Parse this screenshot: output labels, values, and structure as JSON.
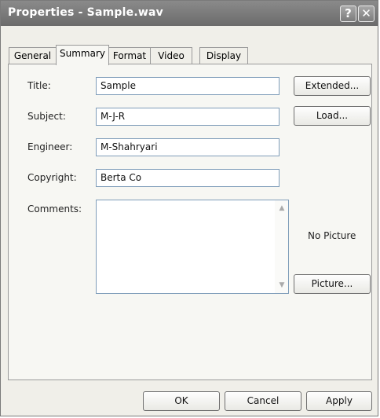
{
  "window": {
    "title": "Properties - Sample.wav",
    "help_glyph": "?",
    "close_glyph": "✕"
  },
  "tabs": [
    {
      "label": "General"
    },
    {
      "label": "Summary"
    },
    {
      "label": "Format"
    },
    {
      "label": "Video"
    },
    {
      "label": "Display"
    }
  ],
  "form": {
    "title": {
      "label": "Title:",
      "value": "Sample"
    },
    "subject": {
      "label": "Subject:",
      "value": "M-J-R"
    },
    "engineer": {
      "label": "Engineer:",
      "value": "M-Shahryari"
    },
    "copyright": {
      "label": "Copyright:",
      "value": "Berta Co"
    },
    "comments": {
      "label": "Comments:",
      "value": ""
    }
  },
  "side": {
    "extended_label": "Extended...",
    "load_label": "Load...",
    "no_picture": "No Picture",
    "picture_label": "Picture..."
  },
  "footer": {
    "ok": "OK",
    "cancel": "Cancel",
    "apply": "Apply"
  },
  "colors": {
    "titlebar": "#7a7a7a",
    "dialog_bg": "#f0efe9",
    "panel_bg": "#f7f7f3",
    "field_border": "#7f9db9"
  }
}
